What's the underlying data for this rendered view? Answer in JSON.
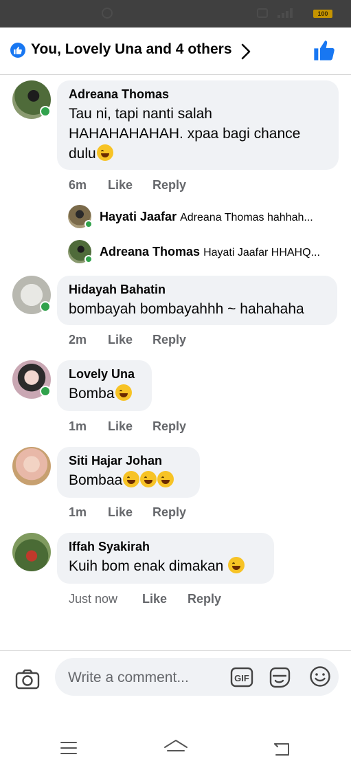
{
  "status_bar": {
    "battery": "100"
  },
  "header": {
    "title": "You, Lovely Una and 4 others"
  },
  "comments": [
    {
      "author": "Adreana Thomas",
      "text": "Tau ni, tapi nanti salah HAHAHAHAHAH. xpaa bagi chance dulu",
      "time": "6m",
      "like": "Like",
      "reply": "Reply"
    },
    {
      "author": "Hidayah Bahatin",
      "text": "bombayah bombayahhh ~ hahahaha",
      "time": "2m",
      "like": "Like",
      "reply": "Reply"
    },
    {
      "author": "Lovely Una",
      "text": "Bomba",
      "time": "1m",
      "like": "Like",
      "reply": "Reply"
    },
    {
      "author": "Siti Hajar Johan",
      "text": "Bombaa",
      "time": "1m",
      "like": "Like",
      "reply": "Reply"
    },
    {
      "author": "Iffah Syakirah",
      "text": "Kuih bom enak dimakan ",
      "time": "Just now",
      "like": "Like",
      "reply": "Reply"
    }
  ],
  "replies": [
    {
      "author": "Hayati Jaafar",
      "text": "Adreana Thomas hahhah..."
    },
    {
      "author": "Adreana Thomas",
      "text": "Hayati Jaafar HHAHQ..."
    }
  ],
  "composer": {
    "placeholder": "Write a comment..."
  },
  "colors": {
    "accent": "#1877f2",
    "bubble": "#f0f2f5",
    "online": "#31a24c",
    "meta": "#65676b"
  },
  "icons": [
    "like-icon",
    "chevron-right-icon",
    "camera-icon",
    "gif-icon",
    "sticker-icon",
    "smile-icon",
    "menu-icon",
    "home-icon",
    "back-icon"
  ]
}
